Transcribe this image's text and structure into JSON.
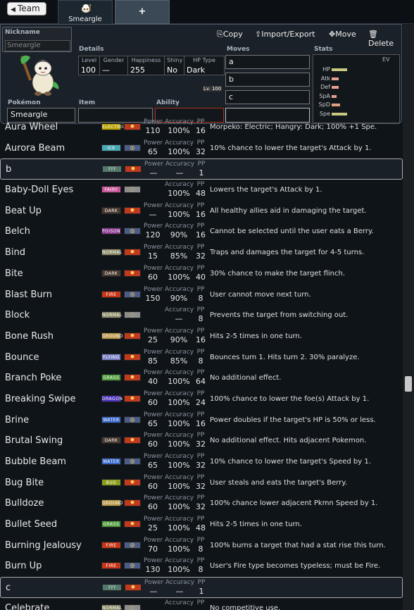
{
  "topbar": {
    "team_label": "Team",
    "tab_active_label": "Smeargle",
    "tab_add_label": "+"
  },
  "editor": {
    "nickname_label": "Nickname",
    "nickname_placeholder": "Smeargle",
    "actions": {
      "copy": "Copy",
      "import_export": "Import/Export",
      "move": "Move",
      "delete": "Delete"
    },
    "details_label": "Details",
    "details": [
      {
        "title": "Level",
        "value": "100"
      },
      {
        "title": "Gender",
        "value": "—"
      },
      {
        "title": "Happiness",
        "value": "255"
      },
      {
        "title": "Shiny",
        "value": "No"
      },
      {
        "title": "HP Type",
        "value": "Dark"
      }
    ],
    "moves_label": "Moves",
    "moves": [
      "a",
      "b",
      "c",
      ""
    ],
    "stats_label": "Stats",
    "ev_label": "EV",
    "stats": [
      {
        "name": "HP",
        "level": 0.9
      },
      {
        "name": "Atk",
        "level": 0.4
      },
      {
        "name": "Def",
        "level": 0.4
      },
      {
        "name": "SpA",
        "level": 0.3
      },
      {
        "name": "SpD",
        "level": 0.5
      },
      {
        "name": "Spe",
        "level": 0.9
      }
    ],
    "pokemon_label": "Pokémon",
    "pokemon_value": "Smeargle",
    "item_label": "Item",
    "ability_label": "Ability",
    "level_tag": "Lv. 100"
  },
  "col_headers": {
    "power": "Power",
    "accuracy": "Accuracy",
    "pp": "PP"
  },
  "moves_list": [
    {
      "name": "Aura Wheel",
      "type": "ELECTRIC",
      "color": "#b8a000",
      "cat": "phys",
      "power": "110",
      "acc": "100%",
      "pp": "16",
      "desc": "Morpeko: Electric; Hangry: Dark; 100% +1 Spe."
    },
    {
      "name": "Aurora Beam",
      "type": "ICE",
      "color": "#4aa8b6",
      "cat": "spec",
      "power": "65",
      "acc": "100%",
      "pp": "32",
      "desc": "10% chance to lower the target's Attack by 1."
    },
    {
      "name": "b",
      "type": "???",
      "color": "#53786c",
      "cat": "phys",
      "power": "—",
      "acc": "—",
      "pp": "1",
      "desc": "",
      "sel": true
    },
    {
      "name": "Baby-Doll Eyes",
      "type": "FAIRY",
      "color": "#c8589a",
      "cat": "stat",
      "power": "",
      "acc": "100%",
      "pp": "48",
      "desc": "Lowers the target's Attack by 1."
    },
    {
      "name": "Beat Up",
      "type": "DARK",
      "color": "#4a3a30",
      "cat": "phys",
      "power": "—",
      "acc": "100%",
      "pp": "16",
      "desc": "All healthy allies aid in damaging the target."
    },
    {
      "name": "Belch",
      "type": "POISON",
      "color": "#8a3a90",
      "cat": "spec",
      "power": "120",
      "acc": "90%",
      "pp": "16",
      "desc": "Cannot be selected until the user eats a Berry."
    },
    {
      "name": "Bind",
      "type": "NORMAL",
      "color": "#8a8a68",
      "cat": "phys",
      "power": "15",
      "acc": "85%",
      "pp": "32",
      "desc": "Traps and damages the target for 4-5 turns."
    },
    {
      "name": "Bite",
      "type": "DARK",
      "color": "#4a3a30",
      "cat": "phys",
      "power": "60",
      "acc": "100%",
      "pp": "40",
      "desc": "30% chance to make the target flinch."
    },
    {
      "name": "Blast Burn",
      "type": "FIRE",
      "color": "#c8361a",
      "cat": "spec",
      "power": "150",
      "acc": "90%",
      "pp": "8",
      "desc": "User cannot move next turn."
    },
    {
      "name": "Block",
      "type": "NORMAL",
      "color": "#8a8a68",
      "cat": "stat",
      "power": "",
      "acc": "—",
      "pp": "8",
      "desc": "Prevents the target from switching out."
    },
    {
      "name": "Bone Rush",
      "type": "GROUND",
      "color": "#b89848",
      "cat": "phys",
      "power": "25",
      "acc": "90%",
      "pp": "16",
      "desc": "Hits 2-5 times in one turn."
    },
    {
      "name": "Bounce",
      "type": "FLYING",
      "color": "#7a80c8",
      "cat": "phys",
      "power": "85",
      "acc": "85%",
      "pp": "8",
      "desc": "Bounces turn 1. Hits turn 2. 30% paralyze."
    },
    {
      "name": "Branch Poke",
      "type": "GRASS",
      "color": "#4e9a3a",
      "cat": "phys",
      "power": "40",
      "acc": "100%",
      "pp": "64",
      "desc": "No additional effect."
    },
    {
      "name": "Breaking Swipe",
      "type": "DRAGON",
      "color": "#4a30b8",
      "cat": "phys",
      "power": "60",
      "acc": "100%",
      "pp": "24",
      "desc": "100% chance to lower the foe(s) Attack by 1."
    },
    {
      "name": "Brine",
      "type": "WATER",
      "color": "#3a68c8",
      "cat": "spec",
      "power": "65",
      "acc": "100%",
      "pp": "16",
      "desc": "Power doubles if the target's HP is 50% or less."
    },
    {
      "name": "Brutal Swing",
      "type": "DARK",
      "color": "#4a3a30",
      "cat": "phys",
      "power": "60",
      "acc": "100%",
      "pp": "32",
      "desc": "No additional effect. Hits adjacent Pokemon."
    },
    {
      "name": "Bubble Beam",
      "type": "WATER",
      "color": "#3a68c8",
      "cat": "spec",
      "power": "65",
      "acc": "100%",
      "pp": "32",
      "desc": "10% chance to lower the target's Speed by 1."
    },
    {
      "name": "Bug Bite",
      "type": "BUG",
      "color": "#8a9a1a",
      "cat": "phys",
      "power": "60",
      "acc": "100%",
      "pp": "32",
      "desc": "User steals and eats the target's Berry."
    },
    {
      "name": "Bulldoze",
      "type": "GROUND",
      "color": "#b89848",
      "cat": "phys",
      "power": "60",
      "acc": "100%",
      "pp": "32",
      "desc": "100% chance lower adjacent Pkmn Speed by 1."
    },
    {
      "name": "Bullet Seed",
      "type": "GRASS",
      "color": "#4e9a3a",
      "cat": "phys",
      "power": "25",
      "acc": "100%",
      "pp": "48",
      "desc": "Hits 2-5 times in one turn."
    },
    {
      "name": "Burning Jealousy",
      "type": "FIRE",
      "color": "#c8361a",
      "cat": "spec",
      "power": "70",
      "acc": "100%",
      "pp": "8",
      "desc": "100% burns a target that had a stat rise this turn."
    },
    {
      "name": "Burn Up",
      "type": "FIRE",
      "color": "#c8361a",
      "cat": "spec",
      "power": "130",
      "acc": "100%",
      "pp": "8",
      "desc": "User's Fire type becomes typeless; must be Fire."
    },
    {
      "name": "c",
      "type": "???",
      "color": "#53786c",
      "cat": "phys",
      "power": "—",
      "acc": "—",
      "pp": "1",
      "desc": "",
      "sel": true
    },
    {
      "name": "Celebrate",
      "type": "NORMAL",
      "color": "#8a8a68",
      "cat": "stat",
      "power": "",
      "acc": "—",
      "pp": "",
      "desc": "No competitive use."
    }
  ]
}
